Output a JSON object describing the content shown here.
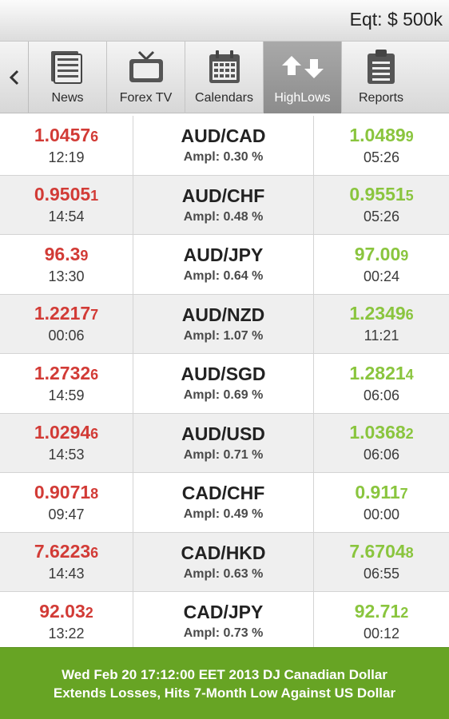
{
  "header": {
    "equity": "Eqt: $ 500k"
  },
  "tabs": [
    {
      "label": "News",
      "icon": "news-icon",
      "active": false
    },
    {
      "label": "Forex TV",
      "icon": "tv-icon",
      "active": false
    },
    {
      "label": "Calendars",
      "icon": "calendar-icon",
      "active": false
    },
    {
      "label": "HighLows",
      "icon": "high-low-arrows-icon",
      "active": true
    },
    {
      "label": "Reports",
      "icon": "clipboard-icon",
      "active": false
    }
  ],
  "rows": [
    {
      "low_main": "1.0457",
      "low_pip": "6",
      "low_time": "12:19",
      "pair": "AUD/CAD",
      "ampl": "Ampl: 0.30 %",
      "high_main": "1.0489",
      "high_pip": "9",
      "high_time": "05:26"
    },
    {
      "low_main": "0.9505",
      "low_pip": "1",
      "low_time": "14:54",
      "pair": "AUD/CHF",
      "ampl": "Ampl: 0.48 %",
      "high_main": "0.9551",
      "high_pip": "5",
      "high_time": "05:26"
    },
    {
      "low_main": "96.3",
      "low_pip": "9",
      "low_time": "13:30",
      "pair": "AUD/JPY",
      "ampl": "Ampl: 0.64 %",
      "high_main": "97.00",
      "high_pip": "9",
      "high_time": "00:24"
    },
    {
      "low_main": "1.2217",
      "low_pip": "7",
      "low_time": "00:06",
      "pair": "AUD/NZD",
      "ampl": "Ampl: 1.07 %",
      "high_main": "1.2349",
      "high_pip": "6",
      "high_time": "11:21"
    },
    {
      "low_main": "1.2732",
      "low_pip": "6",
      "low_time": "14:59",
      "pair": "AUD/SGD",
      "ampl": "Ampl: 0.69 %",
      "high_main": "1.2821",
      "high_pip": "4",
      "high_time": "06:06"
    },
    {
      "low_main": "1.0294",
      "low_pip": "6",
      "low_time": "14:53",
      "pair": "AUD/USD",
      "ampl": "Ampl: 0.71 %",
      "high_main": "1.0368",
      "high_pip": "2",
      "high_time": "06:06"
    },
    {
      "low_main": "0.9071",
      "low_pip": "8",
      "low_time": "09:47",
      "pair": "CAD/CHF",
      "ampl": "Ampl: 0.49 %",
      "high_main": "0.911",
      "high_pip": "7",
      "high_time": "00:00"
    },
    {
      "low_main": "7.6223",
      "low_pip": "6",
      "low_time": "14:43",
      "pair": "CAD/HKD",
      "ampl": "Ampl: 0.63 %",
      "high_main": "7.6704",
      "high_pip": "8",
      "high_time": "06:55"
    },
    {
      "low_main": "92.03",
      "low_pip": "2",
      "low_time": "13:22",
      "pair": "CAD/JPY",
      "ampl": "Ampl: 0.73 %",
      "high_main": "92.71",
      "high_pip": "2",
      "high_time": "00:12"
    }
  ],
  "ticker": {
    "text": "Wed Feb 20 17:12:00 EET 2013  DJ Canadian Dollar\nExtends Losses, Hits 7-Month Low Against US Dollar"
  },
  "colors": {
    "low": "#d23b36",
    "high": "#8ac53e",
    "ticker_bg": "#67a424"
  }
}
